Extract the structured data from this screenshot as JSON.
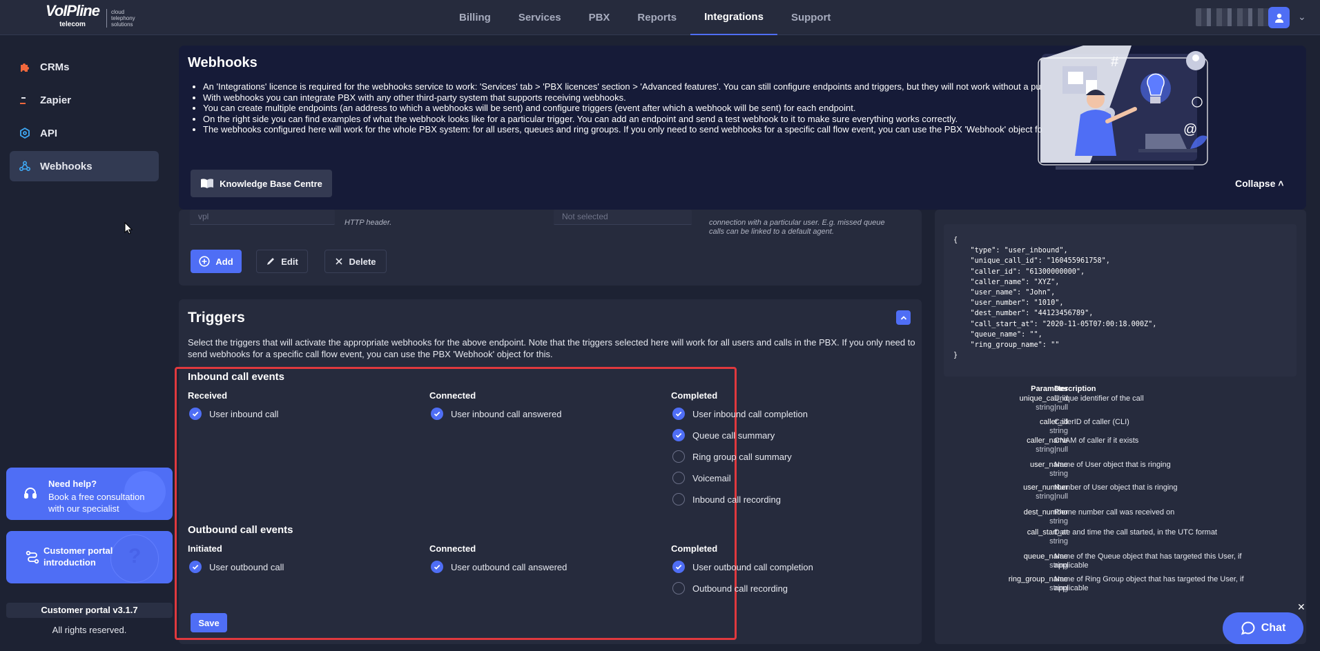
{
  "brand": {
    "logo_main": "VoIPline",
    "logo_small": "telecom",
    "logo_sub": [
      "cloud",
      "telephony",
      "solutions"
    ]
  },
  "nav": {
    "items": [
      {
        "label": "Billing"
      },
      {
        "label": "Services"
      },
      {
        "label": "PBX"
      },
      {
        "label": "Reports"
      },
      {
        "label": "Integrations",
        "active": true
      },
      {
        "label": "Support"
      }
    ]
  },
  "sidebar": {
    "items": [
      {
        "label": "CRMs",
        "icon": "puzzle-icon"
      },
      {
        "label": "Zapier",
        "icon": "zapier-icon"
      },
      {
        "label": "API",
        "icon": "api-icon"
      },
      {
        "label": "Webhooks",
        "icon": "webhook-icon",
        "active": true
      }
    ],
    "help": {
      "title": "Need help?",
      "text": "Book a free consultation with our specialist"
    },
    "intro": {
      "text": "Customer portal introduction"
    },
    "version": "Customer portal v3.1.7",
    "rights": "All rights reserved."
  },
  "banner": {
    "title": "Webhooks",
    "bullets": [
      "An 'Integrations' licence is required for the webhooks service to work: 'Services' tab > 'PBX licences' section > 'Advanced features'. You can still configure endpoints and triggers, but they will not work without a purchased licence.",
      "With webhooks you can integrate PBX with any other third-party system that supports receiving webhooks.",
      "You can create multiple endpoints (an address to which a webhooks will be sent) and configure triggers (event after which a webhook will be sent) for each endpoint.",
      "On the right side you can find examples of what the webhook looks like for a particular trigger. You can add an endpoint and send a test webhook to it to make sure everything works correctly.",
      "The webhooks configured here will work for the whole PBX system: for all users, queues and ring groups. If you only need to send webhooks for a specific call flow event, you can use the PBX 'Webhook' object for this."
    ],
    "kb_button": "Knowledge Base Centre",
    "collapse": "Collapse"
  },
  "endpoints": {
    "field_value": "vpl",
    "header_note": "HTTP header.",
    "select_placeholder": "Not selected",
    "note": "connection with a particular user. E.g. missed queue calls can be linked to a default agent.",
    "add": "Add",
    "edit": "Edit",
    "delete": "Delete"
  },
  "triggers": {
    "title": "Triggers",
    "description": "Select the triggers that will activate the appropriate webhooks for the above endpoint. Note that the triggers selected here will work for all users and calls in the PBX. If you only need to send webhooks for a specific call flow event, you can use the PBX 'Webhook' object for this.",
    "inbound": {
      "title": "Inbound call events",
      "received": {
        "title": "Received",
        "items": [
          {
            "label": "User inbound call",
            "checked": true
          }
        ]
      },
      "connected": {
        "title": "Connected",
        "items": [
          {
            "label": "User inbound call answered",
            "checked": true
          }
        ]
      },
      "completed": {
        "title": "Completed",
        "items": [
          {
            "label": "User inbound call completion",
            "checked": true
          },
          {
            "label": "Queue call summary",
            "checked": true
          },
          {
            "label": "Ring group call summary",
            "checked": false
          },
          {
            "label": "Voicemail",
            "checked": false
          },
          {
            "label": "Inbound call recording",
            "checked": false
          }
        ]
      }
    },
    "outbound": {
      "title": "Outbound call events",
      "initiated": {
        "title": "Initiated",
        "items": [
          {
            "label": "User outbound call",
            "checked": true
          }
        ]
      },
      "connected": {
        "title": "Connected",
        "items": [
          {
            "label": "User outbound call answered",
            "checked": true
          }
        ]
      },
      "completed": {
        "title": "Completed",
        "items": [
          {
            "label": "User outbound call completion",
            "checked": true
          },
          {
            "label": "Outbound call recording",
            "checked": false
          }
        ]
      }
    },
    "save": "Save"
  },
  "example": {
    "code": "{\n    \"type\": \"user_inbound\",\n    \"unique_call_id\": \"160455961758\",\n    \"caller_id\": \"61300000000\",\n    \"caller_name\": \"XYZ\",\n    \"user_name\": \"John\",\n    \"user_number\": \"1010\",\n    \"dest_number\": \"44123456789\",\n    \"call_start_at\": \"2020-11-05T07:00:18.000Z\",\n    \"queue_name\": \"\",\n    \"ring_group_name\": \"\"\n}",
    "param_header": "Parameter",
    "desc_header": "Description",
    "params": [
      {
        "name": "unique_call_id",
        "type": "string|null",
        "desc": "Unique identifier of the call"
      },
      {
        "name": "caller_id",
        "type": "string",
        "desc": "CallerID of caller (CLI)"
      },
      {
        "name": "caller_name",
        "type": "string|null",
        "desc": "CNAM of caller if it exists"
      },
      {
        "name": "user_name",
        "type": "string",
        "desc": "Name of User object that is ringing"
      },
      {
        "name": "user_number",
        "type": "string|null",
        "desc": "Number of User object that is ringing"
      },
      {
        "name": "dest_number",
        "type": "string",
        "desc": "Phone number call was received on"
      },
      {
        "name": "call_start_at",
        "type": "string",
        "desc": "Date and time the call started, in the UTC format"
      },
      {
        "name": "queue_name",
        "type": "string",
        "desc": "Name of the Queue object that has targeted this User, if applicable"
      },
      {
        "name": "ring_group_name",
        "type": "string",
        "desc": "Name of Ring Group object that has targeted the User, if applicable"
      }
    ]
  },
  "chat": {
    "label": "Chat"
  },
  "colors": {
    "accent": "#4f6ef5",
    "highlight": "#e0393e",
    "banner": "#161b38"
  }
}
